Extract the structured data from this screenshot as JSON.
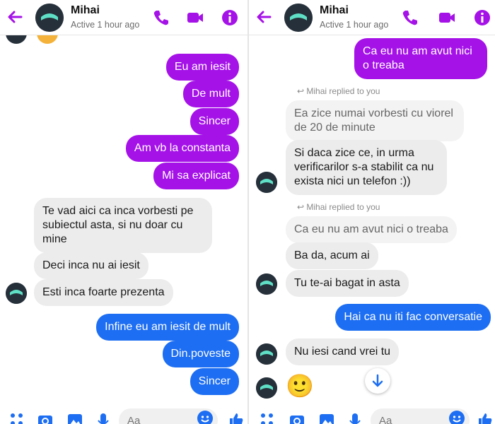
{
  "colors": {
    "accent": "#a512e8",
    "outgoing_blue": "#1d6ef2",
    "incoming": "#ececec"
  },
  "left": {
    "header": {
      "name": "Mihai",
      "status": "Active 1 hour ago"
    },
    "messages": [
      {
        "dir": "out",
        "text": "Eu am iesit"
      },
      {
        "dir": "out",
        "text": "De mult"
      },
      {
        "dir": "out",
        "text": "Sincer"
      },
      {
        "dir": "out",
        "text": "Am vb la constanta"
      },
      {
        "dir": "out",
        "text": "Mi sa explicat"
      },
      {
        "dir": "in",
        "text": "Te vad aici ca inca vorbesti pe subiectul asta, si nu doar cu mine"
      },
      {
        "dir": "in",
        "text": "Deci inca nu ai iesit"
      },
      {
        "dir": "in",
        "text": "Esti inca foarte prezenta"
      },
      {
        "dir": "out",
        "text": "Infine eu am iesit de mult"
      },
      {
        "dir": "out",
        "text": "Din.poveste"
      },
      {
        "dir": "out",
        "text": "Sincer"
      }
    ],
    "composer_placeholder": "Aa"
  },
  "right": {
    "header": {
      "name": "Mihai",
      "status": "Active 1 hour ago"
    },
    "messages": [
      {
        "dir": "out",
        "text": "Ca eu nu am avut nici o treaba"
      },
      {
        "dir": "note",
        "text": "Mihai replied to you"
      },
      {
        "dir": "quote",
        "text": "Ea zice numai vorbesti cu viorel de 20 de minute"
      },
      {
        "dir": "in",
        "text": "Si daca zice ce, in urma verificarilor s-a stabilit ca nu exista nici un telefon :))"
      },
      {
        "dir": "note",
        "text": "Mihai replied to you"
      },
      {
        "dir": "quote",
        "text": "Ca eu nu am avut nici o treaba"
      },
      {
        "dir": "in",
        "text": "Ba da, acum ai"
      },
      {
        "dir": "in",
        "text": "Tu te-ai bagat in asta"
      },
      {
        "dir": "out",
        "text": "Hai ca nu iti fac conversatie"
      },
      {
        "dir": "in",
        "text": "Nu iesi cand vrei tu"
      },
      {
        "dir": "emoji",
        "text": "🙂"
      }
    ],
    "composer_placeholder": "Aa"
  },
  "icons": [
    "back-arrow-icon",
    "phone-icon",
    "video-icon",
    "info-icon",
    "apps-icon",
    "camera-icon",
    "gallery-icon",
    "mic-icon",
    "emoji-icon",
    "thumbs-up-icon",
    "scroll-down-icon"
  ]
}
